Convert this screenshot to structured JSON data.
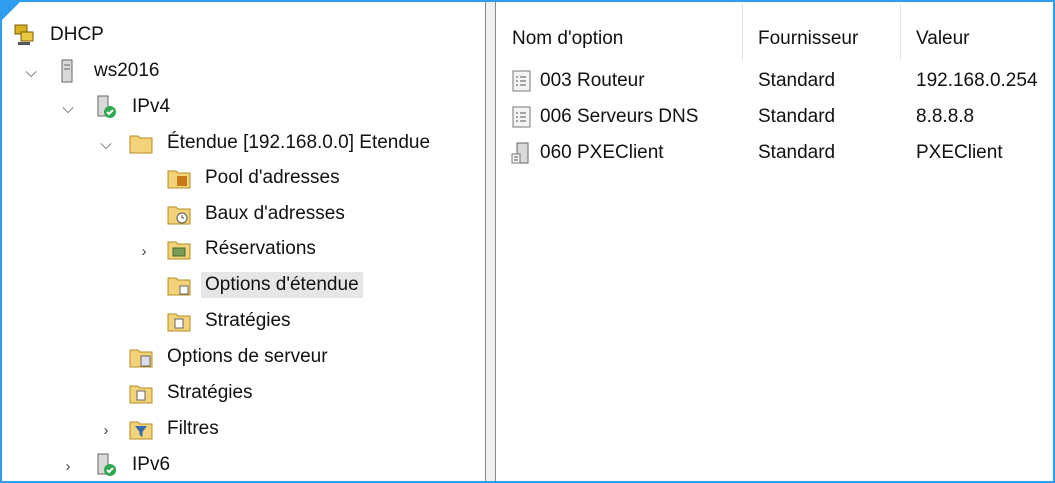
{
  "tree": {
    "root": "DHCP",
    "server": "ws2016",
    "ipv4": "IPv4",
    "scope": "Étendue [192.168.0.0] Etendue",
    "pool": "Pool d'adresses",
    "leases": "Baux d'adresses",
    "reservations": "Réservations",
    "scope_options": "Options d'étendue",
    "scope_policies": "Stratégies",
    "server_options": "Options de serveur",
    "server_policies": "Stratégies",
    "filters": "Filtres",
    "ipv6": "IPv6"
  },
  "list": {
    "columns": [
      "Nom d'option",
      "Fournisseur",
      "Valeur"
    ],
    "rows": [
      {
        "name": "003 Routeur",
        "vendor": "Standard",
        "value": "192.168.0.254"
      },
      {
        "name": "006 Serveurs DNS",
        "vendor": "Standard",
        "value": "8.8.8.8"
      },
      {
        "name": "060 PXEClient",
        "vendor": "Standard",
        "value": "PXEClient"
      }
    ]
  }
}
